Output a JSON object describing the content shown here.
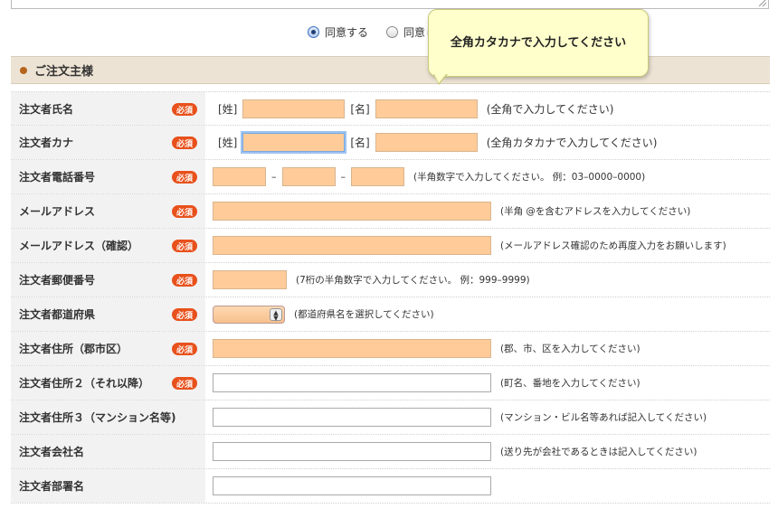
{
  "agreement": {
    "agree_label": "同意する",
    "disagree_label": "同意し"
  },
  "section": {
    "title": "ご注文主様"
  },
  "tooltip": {
    "text": "全角カタカナで入力してください"
  },
  "required_badge": "必須",
  "rows": {
    "name": {
      "label": "注文者氏名",
      "sei": "[姓]",
      "mei": "[名]",
      "hint": "(全角で入力してください)"
    },
    "kana": {
      "label": "注文者カナ",
      "sei": "[姓]",
      "mei": "[名]",
      "hint": "(全角カタカナで入力してください)"
    },
    "phone": {
      "label": "注文者電話番号",
      "dash": "–",
      "hint": "(半角数字で入力してください。 例：03–0000–0000)"
    },
    "email": {
      "label": "メールアドレス",
      "hint": "(半角 @を含むアドレスを入力してください)"
    },
    "email_confirm": {
      "label": "メールアドレス（確認）",
      "hint": "(メールアドレス確認のため再度入力をお願いします)"
    },
    "zip": {
      "label": "注文者郵便番号",
      "hint": "(7桁の半角数字で入力してください。 例：999–9999)"
    },
    "prefecture": {
      "label": "注文者都道府県",
      "hint": "(都道府県名を選択してください)"
    },
    "address1": {
      "label": "注文者住所（郡市区）",
      "hint": "(郡、市、区を入力してください)"
    },
    "address2": {
      "label": "注文者住所２（それ以降）",
      "hint": "(町名、番地を入力してください)"
    },
    "address3": {
      "label": "注文者住所３（マンション名等)",
      "hint": "(マンション・ビル名等あれば記入してください)"
    },
    "company": {
      "label": "注文者会社名",
      "hint": "(送り先が会社であるときは記入してください)"
    },
    "department": {
      "label": "注文者部署名"
    }
  },
  "colors": {
    "required_field_bg": "#ffcc99",
    "required_badge": "#e8511c",
    "section_header_bg": "#ede3d4",
    "tooltip_bg": "#ffffcc"
  }
}
